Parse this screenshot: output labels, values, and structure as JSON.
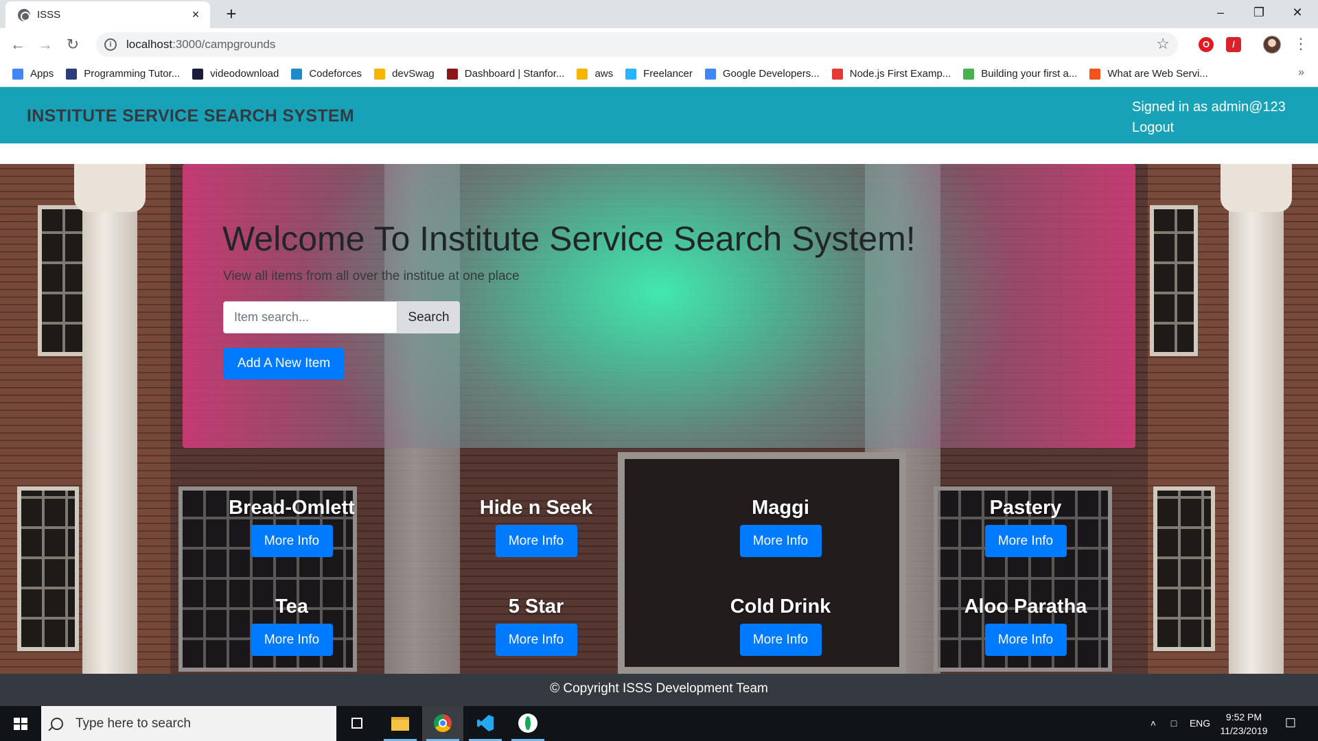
{
  "browser": {
    "tab_title": "ISSS",
    "tab_close": "×",
    "new_tab": "+",
    "url_host": "localhost",
    "url_path": ":3000/campgrounds",
    "bookmarks": [
      {
        "label": "Apps",
        "icon": "apps-grid-icon",
        "color": "#4285f4"
      },
      {
        "label": "Programming Tutor...",
        "icon": "h-icon",
        "color": "#2c3e7a"
      },
      {
        "label": "videodownload",
        "icon": "q-icon",
        "color": "#1b1b3a"
      },
      {
        "label": "Codeforces",
        "icon": "bar-chart-icon",
        "color": "#1f8acb"
      },
      {
        "label": "devSwag",
        "icon": "sunglasses-icon",
        "color": "#f4b400"
      },
      {
        "label": "Dashboard | Stanfor...",
        "icon": "dollar-icon",
        "color": "#8c1515"
      },
      {
        "label": "aws",
        "icon": "cube-icon",
        "color": "#f7b500"
      },
      {
        "label": "Freelancer",
        "icon": "bird-icon",
        "color": "#29b2fe"
      },
      {
        "label": "Google Developers...",
        "icon": "code-icon",
        "color": "#4285f4"
      },
      {
        "label": "Node.js First Examp...",
        "icon": "triangle-icon",
        "color": "#e53935"
      },
      {
        "label": "Building your first a...",
        "icon": "leaf-icon",
        "color": "#4caf50"
      },
      {
        "label": "What are Web Servi...",
        "icon": "circle-g-icon",
        "color": "#f4511e"
      }
    ],
    "bookmarks_more": "»"
  },
  "site": {
    "brand": "INSTITUTE SERVICE SEARCH SYSTEM",
    "signed_in": "Signed in as admin@123",
    "logout": "Logout",
    "hero_title": "Welcome To Institute Service Search System!",
    "hero_subtitle": "View all items from all over the institue at one place",
    "search_placeholder": "Item search...",
    "search_button": "Search",
    "add_button": "Add A New Item",
    "items": [
      {
        "name": "Bread-Omlett",
        "button": "More Info"
      },
      {
        "name": "Hide n Seek",
        "button": "More Info"
      },
      {
        "name": "Maggi",
        "button": "More Info"
      },
      {
        "name": "Pastery",
        "button": "More Info"
      },
      {
        "name": "Tea",
        "button": "More Info"
      },
      {
        "name": "5 Star",
        "button": "More Info"
      },
      {
        "name": "Cold Drink",
        "button": "More Info"
      },
      {
        "name": "Aloo Paratha",
        "button": "More Info"
      }
    ],
    "footer": "© Copyright ISSS Development Team",
    "accent_color": "#17a2b8",
    "button_color": "#007bff"
  },
  "taskbar": {
    "search_placeholder": "Type here to search",
    "language": "ENG",
    "time": "9:52 PM",
    "date": "11/23/2019"
  }
}
